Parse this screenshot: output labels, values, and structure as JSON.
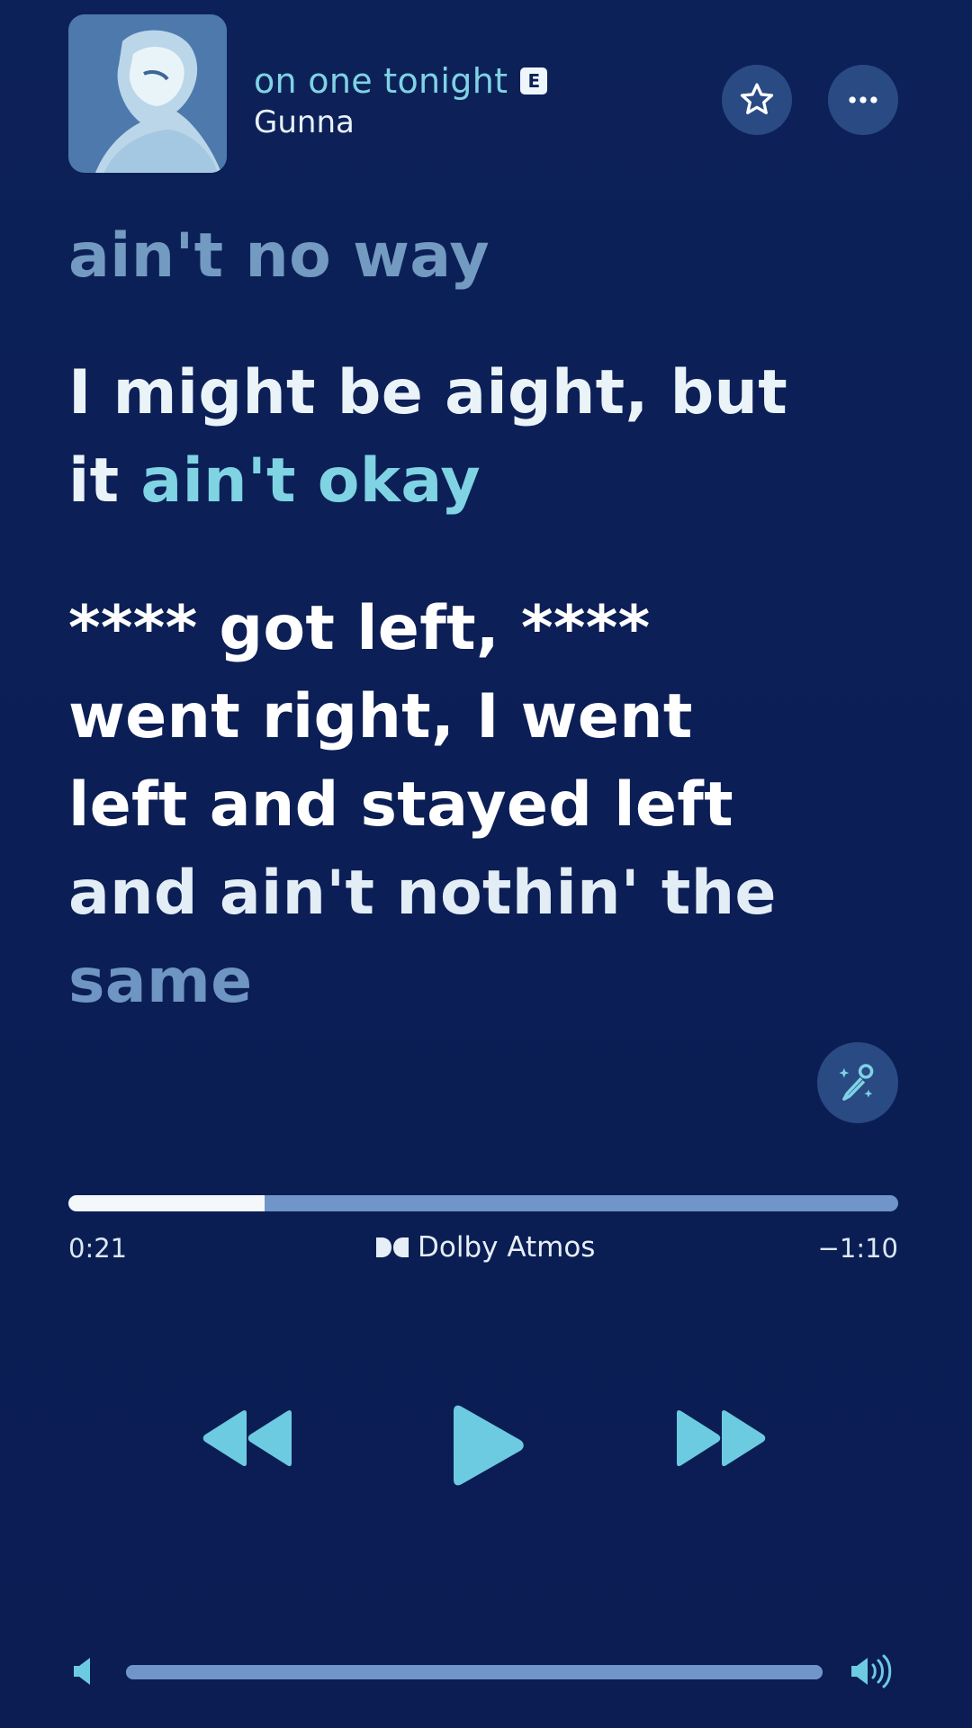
{
  "track": {
    "title": "on one tonight",
    "explicit_badge": "E",
    "artist": "Gunna"
  },
  "lyrics": {
    "previous_line": "ain't no way",
    "current_line_1": "I might be aight, but",
    "current_line_2_sung": "it ",
    "current_line_2_active": "ain't okay",
    "next_lines": [
      "**** got left, ****",
      "went right, I went",
      "left and stayed left",
      "and ain't nothin' the",
      "same"
    ]
  },
  "playback": {
    "elapsed": "0:21",
    "remaining": "−1:10",
    "progress_fraction": 0.236,
    "audio_format": "Dolby Atmos"
  },
  "volume": {
    "level_fraction": 1.0
  },
  "colors": {
    "background": "#0c1f55",
    "accent": "#7fd3e3",
    "button_bg": "#2a4a84",
    "track": "#6f95c9"
  },
  "icons": {
    "favorite": "star-icon",
    "more": "ellipsis-icon",
    "sing": "microphone-sparkle-icon",
    "rewind": "rewind-icon",
    "play": "play-icon",
    "forward": "fast-forward-icon",
    "volume_low": "speaker-low-icon",
    "volume_high": "speaker-high-icon"
  }
}
